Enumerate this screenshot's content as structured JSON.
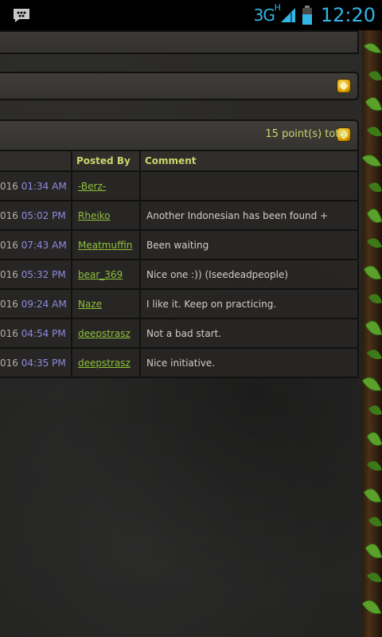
{
  "status_bar": {
    "network": "3G",
    "network_sub": "H",
    "time": "12:20"
  },
  "section": {
    "points_total": "15 point(s) total"
  },
  "table": {
    "headers": [
      "Posted By",
      "Comment"
    ],
    "rows": [
      {
        "year": "016",
        "time": "01:34 AM",
        "user": "-Berz-",
        "comment": ""
      },
      {
        "year": "016",
        "time": "05:02 PM",
        "user": "Rheiko",
        "comment": "Another Indonesian has been found +"
      },
      {
        "year": "016",
        "time": "07:43 AM",
        "user": "Meatmuffin",
        "comment": "Been waiting"
      },
      {
        "year": "016",
        "time": "05:32 PM",
        "user": "bear_369",
        "comment": "Nice one :)) (Iseedeadpeople)"
      },
      {
        "year": "016",
        "time": "09:24 AM",
        "user": "Naze",
        "comment": "I like it. Keep on practicing."
      },
      {
        "year": "016",
        "time": "04:54 PM",
        "user": "deepstrasz",
        "comment": "Not a bad start."
      },
      {
        "year": "016",
        "time": "04:35 PM",
        "user": "deepstrasz",
        "comment": "Nice initiative."
      }
    ]
  },
  "colors": {
    "accent": "#c9d86b",
    "link": "#8fc23a",
    "time": "#8c8ce0",
    "status": "#33b5e5"
  }
}
